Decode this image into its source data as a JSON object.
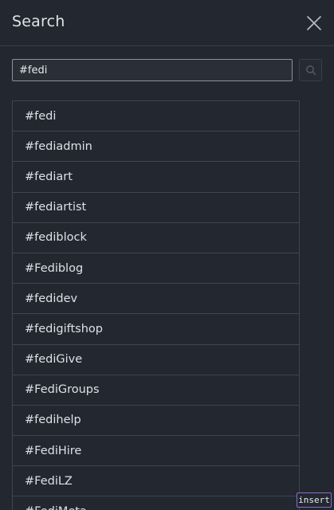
{
  "header": {
    "title": "Search",
    "close_icon": "close-icon"
  },
  "search": {
    "value": "#fedi",
    "button_icon": "search-icon"
  },
  "results": [
    "#fedi",
    "#fediadmin",
    "#fediart",
    "#fediartist",
    "#fediblock",
    "#Fediblog",
    "#fedidev",
    "#fedigiftshop",
    "#fediGive",
    "#FediGroups",
    "#fedihelp",
    "#FediHire",
    "#FediLZ",
    "#FediMeta"
  ],
  "status": {
    "mode": "insert"
  },
  "colors": {
    "background": "#23272f",
    "border": "#40454e",
    "text": "#dde1e7",
    "mode_badge_border": "#8e6ad0"
  }
}
